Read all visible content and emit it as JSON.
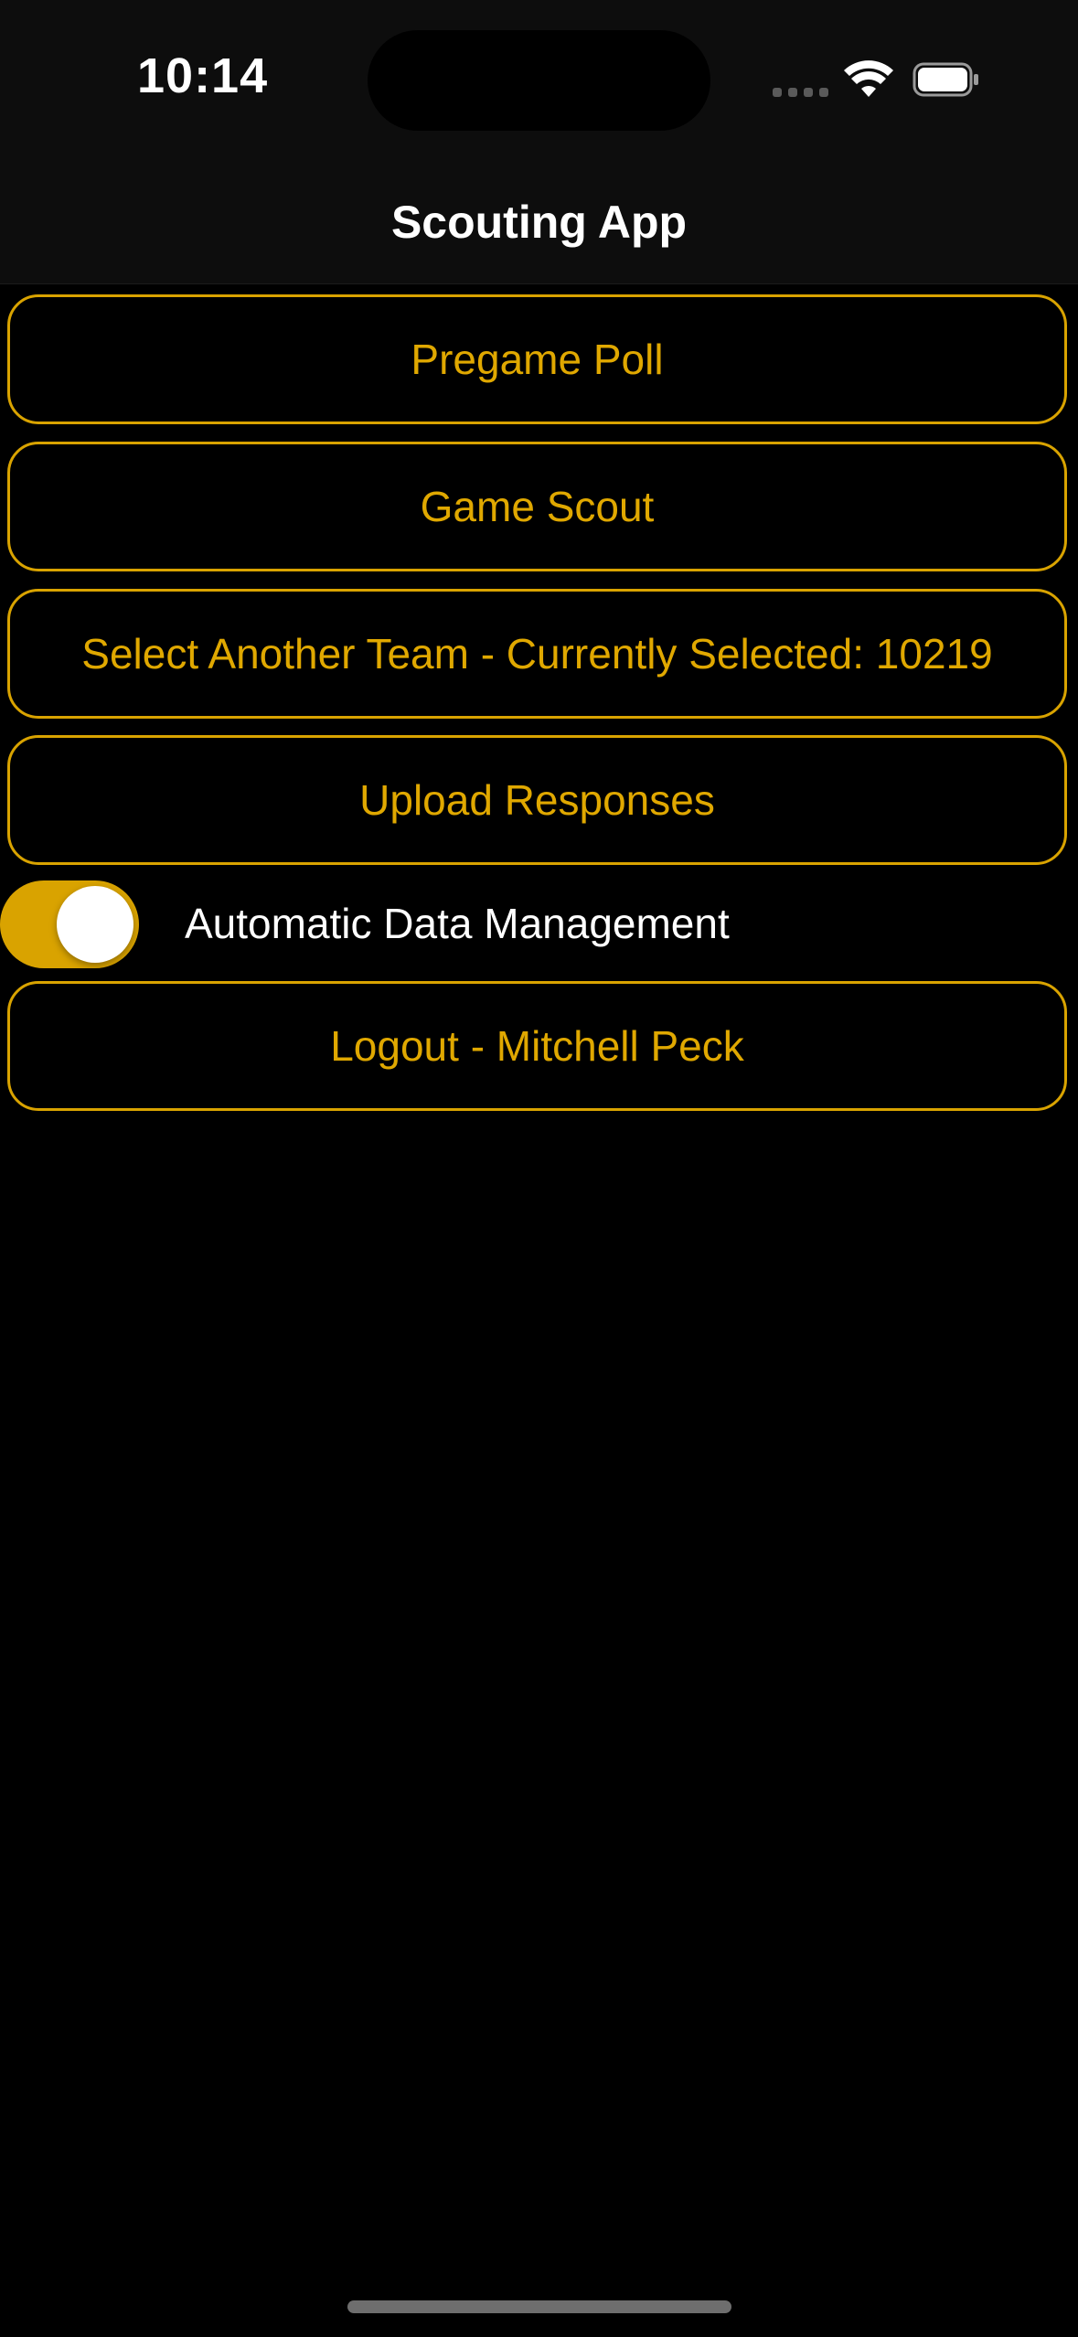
{
  "status_bar": {
    "time": "10:14",
    "signal_icon": "cellular-signal-icon",
    "wifi_icon": "wifi-icon",
    "battery_icon": "battery-icon"
  },
  "nav": {
    "title": "Scouting App"
  },
  "menu": {
    "pregame_poll": "Pregame Poll",
    "game_scout": "Game Scout",
    "select_team": "Select Another Team - Currently Selected: 10219",
    "upload_responses": "Upload Responses",
    "logout": "Logout - Mitchell Peck"
  },
  "toggle": {
    "label": "Automatic Data Management",
    "on": true
  },
  "colors": {
    "accent": "#d9a300",
    "background": "#000000",
    "bar_background": "#0d0d0d",
    "text": "#ffffff"
  }
}
